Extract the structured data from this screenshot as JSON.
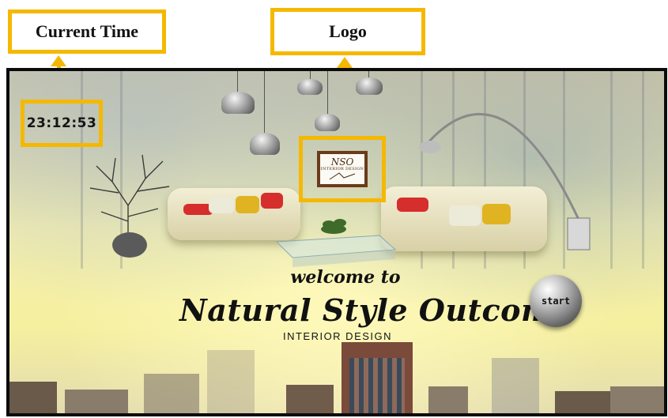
{
  "annotations": {
    "current_time_label": "Current Time",
    "logo_label": "Logo"
  },
  "screen": {
    "clock": "23:12:53",
    "logo": {
      "monogram": "NSO",
      "subtitle": "INTERIOR DESIGN"
    },
    "welcome": "welcome to",
    "brand": "Natural Style Outcome",
    "tagline": "INTERIOR DESIGN",
    "start_label": "start"
  },
  "colors": {
    "annotation": "#f5b800",
    "frame": "#0b0b0b",
    "logo_frame": "#6b3b1a"
  },
  "icons": [
    "pendant-lamp-icon",
    "sofa-icon",
    "plant-icon",
    "arc-lamp-icon",
    "start-orb-icon"
  ]
}
